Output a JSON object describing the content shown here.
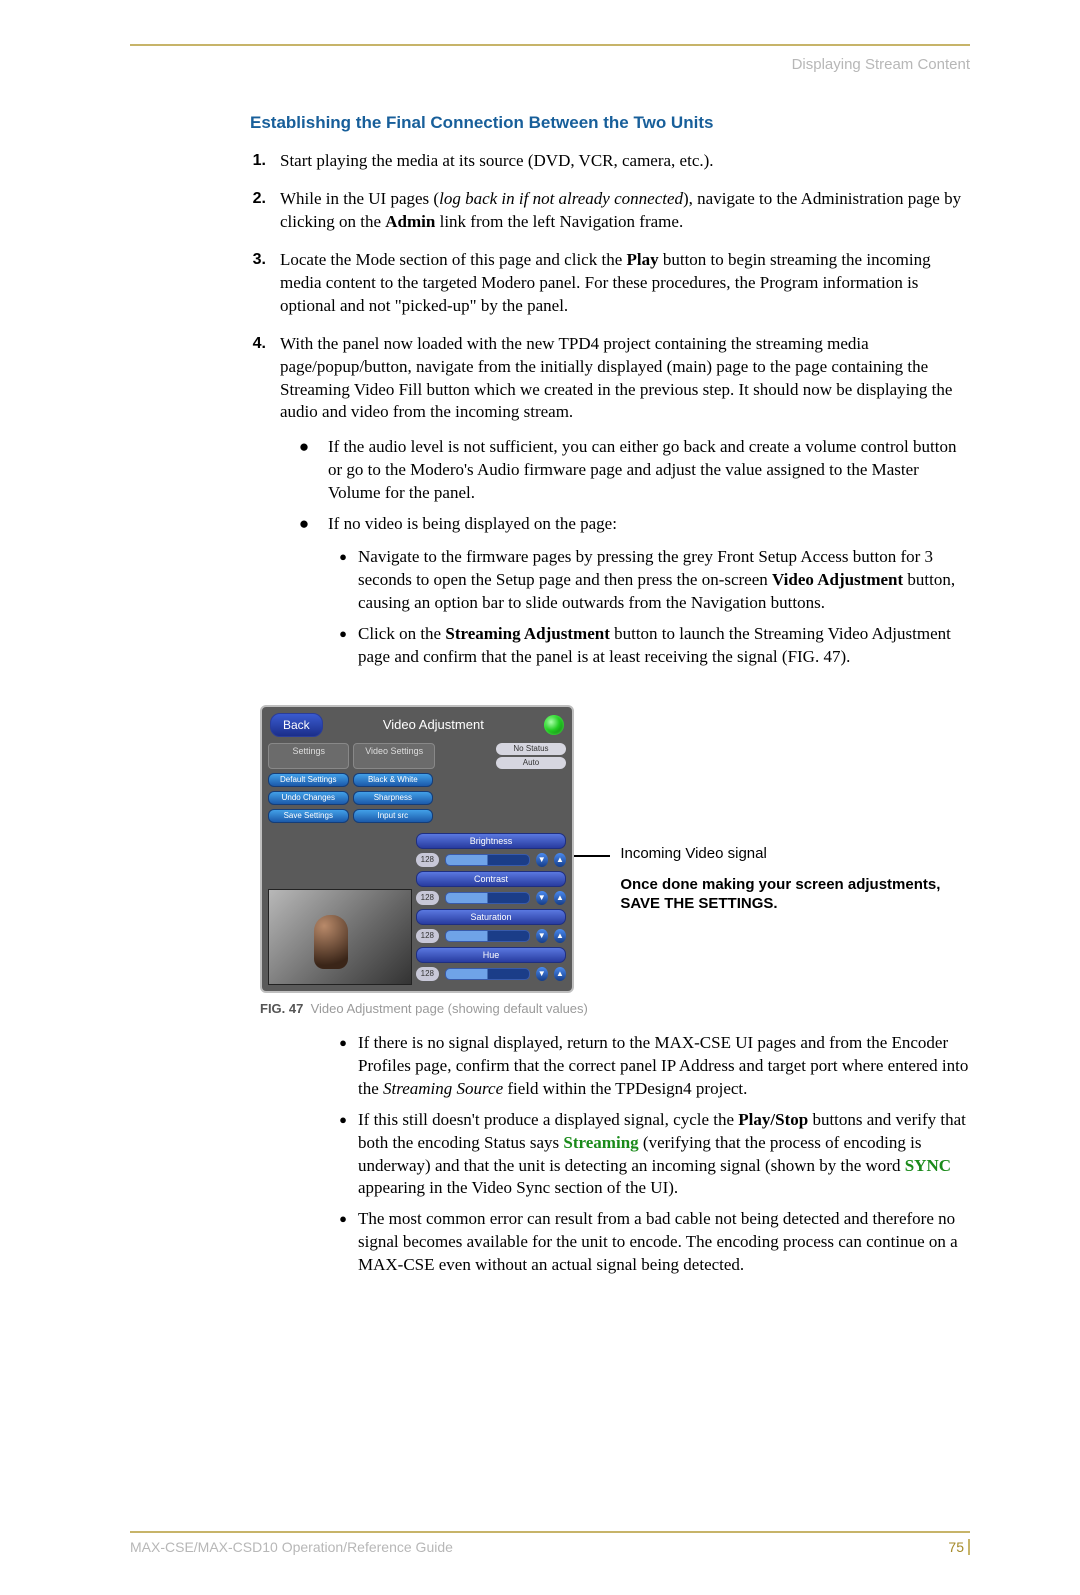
{
  "header": {
    "chapter": "Displaying Stream Content"
  },
  "section": {
    "title": "Establishing the Final Connection Between the Two Units"
  },
  "steps": [
    {
      "num": "1.",
      "text": "Start playing the media at its source (DVD, VCR, camera, etc.)."
    },
    {
      "num": "2.",
      "pre": "While in the UI pages (",
      "italic": "log back in if not already connected",
      "post1": "), navigate to the Administration page by clicking on the ",
      "bold": "Admin",
      "post2": " link from the left Navigation frame."
    },
    {
      "num": "3.",
      "pre": "Locate the Mode section of this page and click the ",
      "bold": "Play",
      "post": " button to begin streaming the incoming media content to the targeted Modero panel. For these procedures, the Program information is optional and not \"picked-up\" by the panel."
    },
    {
      "num": "4.",
      "text": "With the panel now loaded with the new TPD4 project containing the streaming media page/popup/button, navigate from the initially displayed (main) page to the page containing the Streaming Video Fill button which we created in the previous step. It should now be displaying the audio and video from the incoming stream."
    }
  ],
  "bullets1": [
    "If the audio level is not sufficient, you can either go back and create a volume control button or go to the Modero's Audio firmware page and adjust the value assigned to the Master Volume for the panel.",
    "If no video is being displayed on the page:"
  ],
  "bullets2a": [
    {
      "pre": "Navigate to the firmware pages by pressing the grey Front Setup Access button for 3 seconds to open the Setup page and then press the on-screen ",
      "bold": "Video Adjustment",
      "post": " button, causing an option bar to slide outwards from the Navigation buttons."
    },
    {
      "pre": "Click on the ",
      "bold": "Streaming Adjustment",
      "post": " button to launch the Streaming Video Adjustment page and confirm that the panel is at least receiving the signal (FIG. 47)."
    }
  ],
  "bullets2b": [
    {
      "pre": "If there is no signal displayed, return to the MAX-CSE UI pages and from the Encoder Profiles page, confirm that the correct panel IP Address and target port where entered into the ",
      "italic": "Streaming Source",
      "post": " field within the TPDesign4 project."
    },
    {
      "pre": "If this still doesn't produce a displayed signal, cycle the ",
      "bold": "Play/Stop",
      "mid": " buttons and verify that both the encoding Status says ",
      "green1": "Streaming",
      "mid2": " (verifying that the process of encoding is underway) and that the unit is detecting an incoming signal (shown by the word ",
      "green2": "SYNC",
      "post": " appearing in the Video Sync section of the UI)."
    },
    {
      "text": "The most common error can result from a bad cable not being detected and therefore no signal becomes available for the unit to encode. The encoding process can continue on a MAX-CSE even without an actual signal being detected."
    }
  ],
  "figure": {
    "back": "Back",
    "title": "Video Adjustment",
    "col1": "Settings",
    "col2": "Video Settings",
    "noStatus": "No Status",
    "auto": "Auto",
    "btns1": [
      "Default Settings",
      "Undo Changes",
      "Save Settings"
    ],
    "btns2": [
      "Black & White",
      "Sharpness",
      "Input src"
    ],
    "sliders": [
      {
        "label": "Brightness",
        "val": "128"
      },
      {
        "label": "Contrast",
        "val": "128"
      },
      {
        "label": "Saturation",
        "val": "128"
      },
      {
        "label": "Hue",
        "val": "128"
      }
    ],
    "annot1": "Incoming Video signal",
    "annot2": "Once done making your screen adjustments, SAVE THE SETTINGS.",
    "caption_num": "FIG. 47",
    "caption_text": "Video Adjustment page (showing default values)"
  },
  "footer": {
    "doc": "MAX-CSE/MAX-CSD10 Operation/Reference Guide",
    "page": "75"
  }
}
